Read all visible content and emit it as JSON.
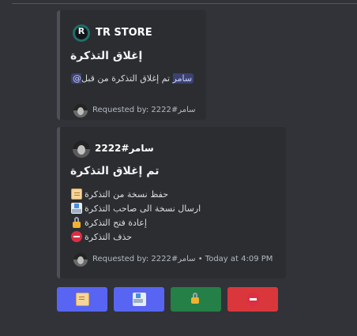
{
  "embed1": {
    "author": "TR STORE",
    "logo_letter": "R",
    "title": "إغلاق التذكرة",
    "desc_text": "تم إغلاق التذكرة من قبل",
    "mention": "@سامر",
    "footer": "Requested by: سامر#2222"
  },
  "embed2": {
    "author": "سامر#2222",
    "title": "تم إغلاق التذكرة",
    "fields": [
      "حفظ نسخة من التذكرة",
      "ارسال نسخة الى صاحب التذكرة",
      "إعادة فتح التذكرة",
      "حذف التذكرة"
    ],
    "footer": "Requested by: سامر#2222 • Today at 4:09 PM"
  },
  "buttons": [
    {
      "icon": "scroll-icon",
      "color": "#5865f2"
    },
    {
      "icon": "envelope-icon",
      "color": "#5865f2"
    },
    {
      "icon": "unlock-icon",
      "color": "#248046"
    },
    {
      "icon": "no-entry-icon",
      "color": "#da373c"
    }
  ],
  "colors": {
    "background": "#313338",
    "embed": "#2b2d31",
    "blurple": "#5865f2",
    "green": "#248046",
    "red": "#da373c"
  }
}
